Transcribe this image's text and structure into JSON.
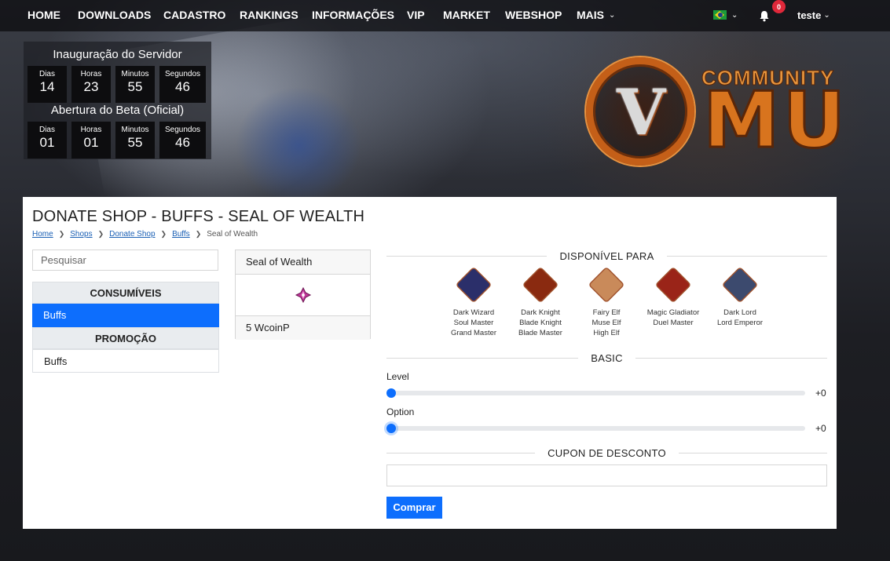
{
  "nav": {
    "items": [
      "HOME",
      "DOWNLOADS",
      "CADASTRO",
      "RANKINGS",
      "INFORMAÇÕES",
      "VIP",
      "MARKET",
      "WEBSHOP",
      "MAIS"
    ],
    "notification_count": "0",
    "username": "teste"
  },
  "countdown": {
    "launch_title": "Inauguração do Servidor",
    "beta_title": "Abertura do Beta (Oficial)",
    "labels": [
      "Dias",
      "Horas",
      "Minutos",
      "Segundos"
    ],
    "launch_values": [
      "14",
      "23",
      "55",
      "46"
    ],
    "beta_values": [
      "01",
      "01",
      "55",
      "46"
    ]
  },
  "logo": {
    "top": "COMMUNITY",
    "main": "MU"
  },
  "page": {
    "title": "DONATE SHOP - BUFFS - SEAL OF WEALTH",
    "breadcrumb": [
      "Home",
      "Shops",
      "Donate Shop",
      "Buffs",
      "Seal of Wealth"
    ]
  },
  "sidebar": {
    "search_placeholder": "Pesquisar",
    "categories": [
      {
        "title": "CONSUMÍVEIS",
        "items": [
          {
            "label": "Buffs",
            "active": true
          }
        ]
      },
      {
        "title": "PROMOÇÃO",
        "items": [
          {
            "label": "Buffs",
            "active": false
          }
        ]
      }
    ]
  },
  "item": {
    "name": "Seal of Wealth",
    "price": "5 WcoinP"
  },
  "right": {
    "available_title": "DISPONÍVEL PARA",
    "classes": [
      {
        "lines": [
          "Dark Wizard",
          "Soul Master",
          "Grand Master"
        ],
        "color": "#2b2f6a"
      },
      {
        "lines": [
          "Dark Knight",
          "Blade Knight",
          "Blade Master"
        ],
        "color": "#8a2a10"
      },
      {
        "lines": [
          "Fairy Elf",
          "Muse Elf",
          "High Elf"
        ],
        "color": "#c98a5a"
      },
      {
        "lines": [
          "Magic Gladiator",
          "Duel Master"
        ],
        "color": "#9a2418"
      },
      {
        "lines": [
          "Dark Lord",
          "Lord Emperor"
        ],
        "color": "#3c4a6e"
      }
    ],
    "basic_title": "BASIC",
    "level": {
      "label": "Level",
      "value": "+0",
      "fraction": 0
    },
    "option": {
      "label": "Option",
      "value": "+0",
      "fraction": 0
    },
    "coupon_title": "CUPON DE DESCONTO",
    "buy_label": "Comprar"
  },
  "colors": {
    "accent": "#0d6efd",
    "badge": "#e0283a",
    "logo_orange": "#d8741e"
  }
}
